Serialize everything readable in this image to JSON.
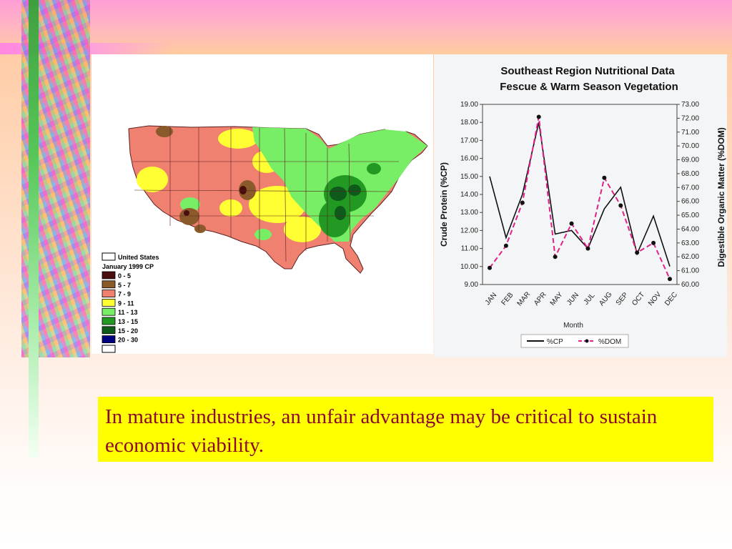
{
  "slide": {
    "caption": "In mature industries, an unfair advantage may be critical to sustain economic viability.",
    "colors": {
      "caption_bg": "#ffff00",
      "caption_text": "#8b0a2a",
      "accent_bar": "#58c85a"
    }
  },
  "map": {
    "legend_title_1": "United States",
    "legend_title_2": "January 1999 CP",
    "legend": [
      {
        "label": "0 - 5",
        "color": "#4a0d0d"
      },
      {
        "label": "5 - 7",
        "color": "#8b5a2b"
      },
      {
        "label": "7 - 9",
        "color": "#f08070"
      },
      {
        "label": "9 - 11",
        "color": "#ffff33"
      },
      {
        "label": "11 - 13",
        "color": "#77ee66"
      },
      {
        "label": "13 - 15",
        "color": "#229922"
      },
      {
        "label": "15 - 20",
        "color": "#0e5a1a"
      },
      {
        "label": "20 - 30",
        "color": "#000080"
      }
    ]
  },
  "chart_data": {
    "type": "line",
    "title": "Southeast Region Nutritional Data",
    "subtitle": "Fescue & Warm Season Vegetation",
    "xlabel": "Month",
    "ylabel": "Crude Protein (%CP)",
    "y2label": "Digestible Organic Matter (%DOM)",
    "categories": [
      "JAN",
      "FEB",
      "MAR",
      "APR",
      "MAY",
      "JUN",
      "JUL",
      "AUG",
      "SEP",
      "OCT",
      "NOV",
      "DEC"
    ],
    "ylim": [
      9.0,
      19.0
    ],
    "y2lim": [
      60.0,
      73.0
    ],
    "y_ticks": [
      "9.00",
      "10.00",
      "11.00",
      "12.00",
      "13.00",
      "14.00",
      "15.00",
      "16.00",
      "17.00",
      "18.00",
      "19.00"
    ],
    "y2_ticks": [
      "60.00",
      "61.00",
      "62.00",
      "63.00",
      "64.00",
      "65.00",
      "66.00",
      "67.00",
      "68.00",
      "69.00",
      "70.00",
      "71.00",
      "72.00",
      "73.00"
    ],
    "series": [
      {
        "name": "%CP",
        "axis": "left",
        "color": "#111111",
        "style": "solid",
        "values": [
          15.0,
          11.6,
          14.0,
          18.0,
          11.8,
          12.0,
          11.0,
          13.2,
          14.4,
          10.7,
          12.8,
          10.0
        ]
      },
      {
        "name": "%DOM",
        "axis": "right",
        "color": "#e0218a",
        "style": "dashed",
        "values": [
          61.2,
          62.8,
          65.9,
          72.1,
          62.0,
          64.4,
          62.6,
          67.7,
          65.7,
          62.3,
          63.0,
          60.4
        ]
      }
    ],
    "legend_position": "bottom",
    "grid": false
  }
}
